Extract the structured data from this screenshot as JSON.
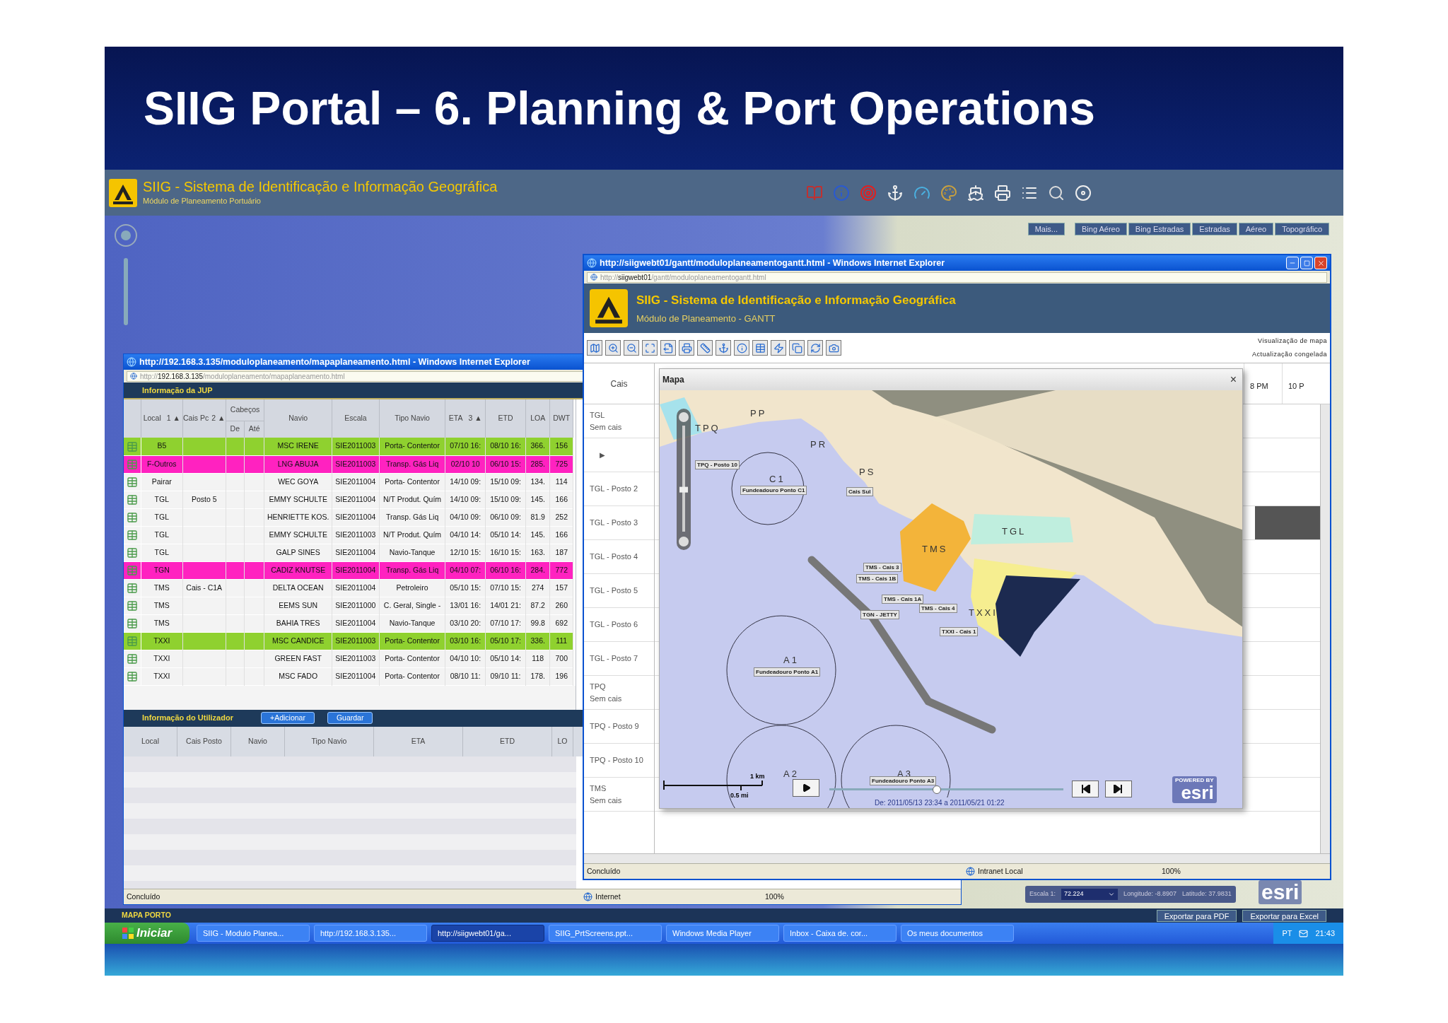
{
  "slide": {
    "title": "SIIG Portal – 6. Planning & Port Operations"
  },
  "app": {
    "title": "SIIG - Sistema de Identificação e Informação Geográfica",
    "subtitle": "Módulo de Planeamento Portuário"
  },
  "layers": [
    "Mais...",
    "Bing Aéreo",
    "Bing Estradas",
    "Estradas",
    "Aéreo",
    "Topográfico"
  ],
  "jup_window": {
    "title": "http://192.168.3.135/moduloplaneamento/mapaplaneamento.html - Windows Internet Explorer",
    "address": {
      "scheme": "http://",
      "host": "192.168.3.135",
      "path": "/moduloplaneamento/mapaplaneamento.html"
    },
    "section": "Informação da JUP",
    "columns": {
      "local": "Local",
      "local_sort": "1 ▲",
      "cais": "Cais Pc",
      "cais_sort": "2 ▲",
      "cabecos": "Cabeços",
      "de": "De",
      "ate": "Até",
      "navio": "Navio",
      "escala": "Escala",
      "tipo": "Tipo Navio",
      "eta": "ETA",
      "eta_sort": "3 ▲",
      "etd": "ETD",
      "loa": "LOA",
      "dwt": "DWT"
    },
    "rows": [
      {
        "color": "#8fd12f",
        "local": "B5",
        "navio": "MSC IRENE",
        "escala": "SIE2011003",
        "tipo": "Porta- Contentor",
        "eta": "07/10 16:",
        "etd": "08/10 16:",
        "loa": "366.",
        "dwt": "156"
      },
      {
        "color": "#ff22c0",
        "local": "F-Outros",
        "navio": "LNG ABUJA",
        "escala": "SIE2011003",
        "tipo": "Transp. Gás Liq",
        "eta": "02/10 10",
        "etd": "06/10 15:",
        "loa": "285.",
        "dwt": "725"
      },
      {
        "color": "#f3f3f3",
        "local": "Pairar",
        "navio": "WEC GOYA",
        "escala": "SIE2011004",
        "tipo": "Porta- Contentor",
        "eta": "14/10 09:",
        "etd": "15/10 09:",
        "loa": "134.",
        "dwt": "114"
      },
      {
        "color": "#f3f3f3",
        "local": "TGL",
        "cais": "Posto 5",
        "navio": "EMMY SCHULTE",
        "escala": "SIE2011004",
        "tipo": "N/T Produt. Quím",
        "eta": "14/10 09:",
        "etd": "15/10 09:",
        "loa": "145.",
        "dwt": "166"
      },
      {
        "color": "#f3f3f3",
        "local": "TGL",
        "navio": "HENRIETTE KOS.",
        "escala": "SIE2011004",
        "tipo": "Transp. Gás Liq",
        "eta": "04/10 09:",
        "etd": "06/10 09:",
        "loa": "81.9",
        "dwt": "252"
      },
      {
        "color": "#f3f3f3",
        "local": "TGL",
        "navio": "EMMY SCHULTE",
        "escala": "SIE2011003",
        "tipo": "N/T Produt. Quím",
        "eta": "04/10 14:",
        "etd": "05/10 14:",
        "loa": "145.",
        "dwt": "166"
      },
      {
        "color": "#f3f3f3",
        "local": "TGL",
        "navio": "GALP SINES",
        "escala": "SIE2011004",
        "tipo": "Navio-Tanque",
        "eta": "12/10 15:",
        "etd": "16/10 15:",
        "loa": "163.",
        "dwt": "187"
      },
      {
        "color": "#ff22c0",
        "local": "TGN",
        "navio": "CADIZ KNUTSE",
        "escala": "SIE2011004",
        "tipo": "Transp. Gás Liq",
        "eta": "04/10 07:",
        "etd": "06/10 16:",
        "loa": "284.",
        "dwt": "772"
      },
      {
        "color": "#f3f3f3",
        "local": "TMS",
        "cais": "Cais - C1A",
        "navio": "DELTA OCEAN",
        "escala": "SIE2011004",
        "tipo": "Petroleiro",
        "eta": "05/10 15:",
        "etd": "07/10 15:",
        "loa": "274",
        "dwt": "157"
      },
      {
        "color": "#f3f3f3",
        "local": "TMS",
        "navio": "EEMS SUN",
        "escala": "SIE2011000",
        "tipo": "C. Geral, Single -",
        "eta": "13/01 16:",
        "etd": "14/01 21:",
        "loa": "87.2",
        "dwt": "260"
      },
      {
        "color": "#f3f3f3",
        "local": "TMS",
        "navio": "BAHIA TRES",
        "escala": "SIE2011004",
        "tipo": "Navio-Tanque",
        "eta": "03/10 20:",
        "etd": "07/10 17:",
        "loa": "99.8",
        "dwt": "692"
      },
      {
        "color": "#8fd12f",
        "local": "TXXI",
        "navio": "MSC CANDICE",
        "escala": "SIE2011003",
        "tipo": "Porta- Contentor",
        "eta": "03/10 16:",
        "etd": "05/10 17:",
        "loa": "336.",
        "dwt": "111"
      },
      {
        "color": "#f3f3f3",
        "local": "TXXI",
        "navio": "GREEN FAST",
        "escala": "SIE2011003",
        "tipo": "Porta- Contentor",
        "eta": "04/10 10:",
        "etd": "05/10 14:",
        "loa": "118",
        "dwt": "700"
      },
      {
        "color": "#f3f3f3",
        "local": "TXXI",
        "navio": "MSC FADO",
        "escala": "SIE2011004",
        "tipo": "Porta- Contentor",
        "eta": "08/10 11:",
        "etd": "09/10 11:",
        "loa": "178.",
        "dwt": "196"
      }
    ],
    "user_section": "Informação do Utilizador",
    "user_buttons": [
      "+Adicionar",
      "Guardar"
    ],
    "user_columns": [
      "Local",
      "Cais Posto",
      "Navio",
      "Tipo Navio",
      "ETA",
      "ETD",
      "LO"
    ],
    "status": {
      "text": "Concluído",
      "zone": "Internet",
      "zoom": "100%"
    }
  },
  "gantt_window": {
    "title": "http://siigwebt01/gantt/moduloplaneamentogantt.html - Windows Internet Explorer",
    "address": {
      "scheme": "http://",
      "host": "siigwebt01",
      "path": "/gantt/moduloplaneamentogantt.html"
    },
    "header_title": "SIIG - Sistema de Identificação e Informação Geográfica",
    "header_subtitle": "Módulo de Planeamento - GANTT",
    "toolbar_notes": [
      "Visualização de mapa",
      "Actualização congelada"
    ],
    "list_header": "Cais",
    "rows": [
      {
        "kind": "berth",
        "label": "TGL",
        "sublabel": "Sem cais",
        "occupied": false
      },
      {
        "kind": "expander",
        "label": "▶",
        "occupied": false
      },
      {
        "kind": "berth",
        "label": "TGL - Posto 2",
        "occupied": false
      },
      {
        "kind": "berth",
        "label": "TGL - Posto 3",
        "occupied": true
      },
      {
        "kind": "berth",
        "label": "TGL - Posto 4",
        "occupied": false
      },
      {
        "kind": "berth",
        "label": "TGL - Posto 5",
        "occupied": false
      },
      {
        "kind": "berth",
        "label": "TGL - Posto 6",
        "occupied": false
      },
      {
        "kind": "berth",
        "label": "TGL - Posto 7",
        "occupied": false
      },
      {
        "kind": "berth",
        "label": "TPQ",
        "sublabel": "Sem cais",
        "occupied": false
      },
      {
        "kind": "berth",
        "label": "TPQ - Posto 9",
        "occupied": false
      },
      {
        "kind": "berth",
        "label": "TPQ - Posto 10",
        "occupied": false
      },
      {
        "kind": "berth",
        "label": "TMS",
        "sublabel": "Sem cais",
        "occupied": false
      }
    ],
    "timeline": [
      "8 PM",
      "10 P"
    ],
    "map": {
      "title": "Mapa",
      "close": "×",
      "labels": [
        {
          "kind": "area",
          "text": "PP"
        },
        {
          "kind": "area",
          "text": "TPQ"
        },
        {
          "kind": "area",
          "text": "PR"
        },
        {
          "kind": "area",
          "text": "PS"
        },
        {
          "kind": "area",
          "text": "C1"
        },
        {
          "kind": "tag",
          "text": "Fundeadouro Ponto C1"
        },
        {
          "kind": "tag",
          "text": "Cais Sul"
        },
        {
          "kind": "area",
          "text": "TMS"
        },
        {
          "kind": "area",
          "text": "TGL"
        },
        {
          "kind": "tag",
          "text": "TMS - Cais 3"
        },
        {
          "kind": "tag",
          "text": "TMS - Cais 1B"
        },
        {
          "kind": "tag",
          "text": "TMS - Cais 1A"
        },
        {
          "kind": "tag",
          "text": "TMS - Cais 4"
        },
        {
          "kind": "tag",
          "text": "TGN - JETTY"
        },
        {
          "kind": "area",
          "text": "TXXI"
        },
        {
          "kind": "tag",
          "text": "TXXI - Cais 1"
        },
        {
          "kind": "area",
          "text": "A1"
        },
        {
          "kind": "tag",
          "text": "Fundeadouro Ponto A1"
        },
        {
          "kind": "area",
          "text": "A2"
        },
        {
          "kind": "area",
          "text": "A3"
        },
        {
          "kind": "tag",
          "text": "Fundeadouro Ponto A3"
        },
        {
          "kind": "tag",
          "text": "TPQ - Posto 10"
        }
      ],
      "zoom_slider": {
        "level": 0.39
      },
      "scale": [
        "1 km",
        "0.5 mi"
      ],
      "time_slider": {
        "level": 0.46
      },
      "date": "De: 2011/05/13 23:34 a 2011/05/21 01:22",
      "logo": {
        "top": "POWERED BY",
        "name": "esri"
      }
    },
    "status": {
      "text": "Concluído",
      "zone": "Intranet Local",
      "zoom": "100%"
    }
  },
  "coords": {
    "scale_label": "Escala 1:",
    "scale_value": "72.224",
    "longitude": "Longitude: -8.8907",
    "latitude": "Latitude: 37.9831",
    "logo": "esri"
  },
  "map_bar": {
    "title": "MAPA PORTO",
    "buttons": [
      "Exportar para PDF",
      "Exportar para Excel"
    ]
  },
  "taskbar": {
    "start": "Iniciar",
    "tasks": [
      {
        "label": "SIIG - Modulo Planea...",
        "selected": false
      },
      {
        "label": "http://192.168.3.135...",
        "selected": false
      },
      {
        "label": "http://siigwebt01/ga...",
        "selected": true
      },
      {
        "label": "SIIG_PrtScreens.ppt...",
        "selected": false
      },
      {
        "label": "Windows Media Player",
        "selected": false
      },
      {
        "label": "Inbox - Caixa de. cor...",
        "selected": false
      },
      {
        "label": "Os meus documentos",
        "selected": false
      }
    ],
    "language": "PT",
    "clock": "21:43"
  }
}
